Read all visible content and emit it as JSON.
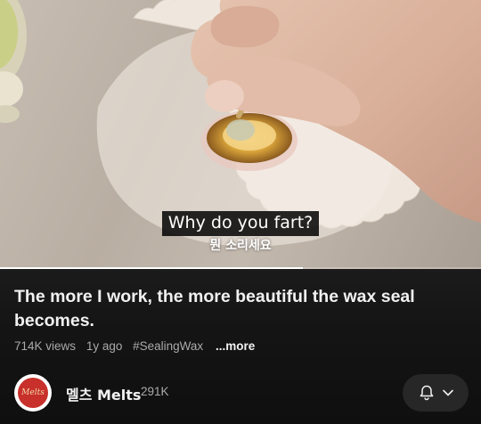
{
  "video": {
    "caption_en": "Why do you fart?",
    "caption_ko": "뭔 소리세요",
    "progress": 0.63
  },
  "details": {
    "title": "The more I work, the more beautiful the wax seal becomes.",
    "views": "714K views",
    "age": "1y ago",
    "hashtag": "#SealingWax",
    "more": "...more"
  },
  "channel": {
    "avatar_text": "Melts",
    "name": "멜츠 Melts",
    "subscribers": "291K"
  },
  "icons": {
    "bell": "bell-icon",
    "chevron": "chevron-down-icon"
  }
}
